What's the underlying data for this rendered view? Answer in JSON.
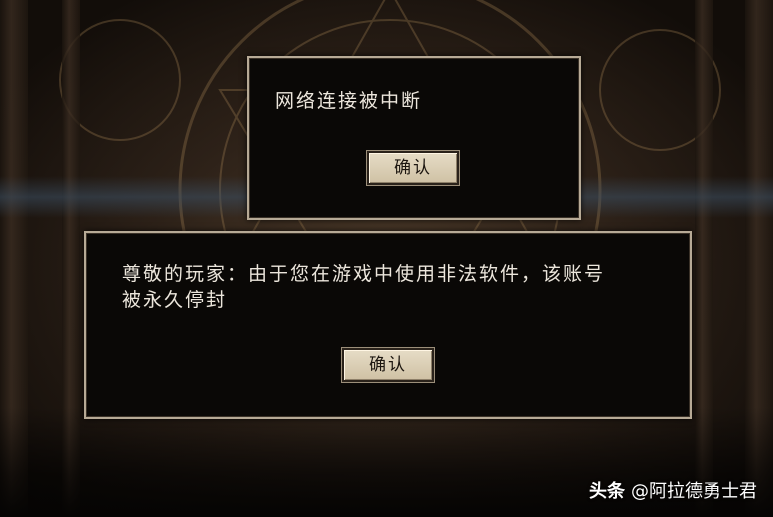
{
  "dialogs": [
    {
      "message": "网络连接被中断",
      "button_label": "确认"
    },
    {
      "message_line1": "尊敬的玩家：由于您在游戏中使用非法软件，该账号",
      "message_line2": "被永久停封",
      "button_label": "确认"
    }
  ],
  "watermark": {
    "brand": "头条",
    "account": "@阿拉德勇士君"
  },
  "colors": {
    "dialog_bg": "#0a0806",
    "dialog_border": "#b7aa96",
    "button_bg": "#d8ccb2",
    "text": "#ece6dc"
  }
}
